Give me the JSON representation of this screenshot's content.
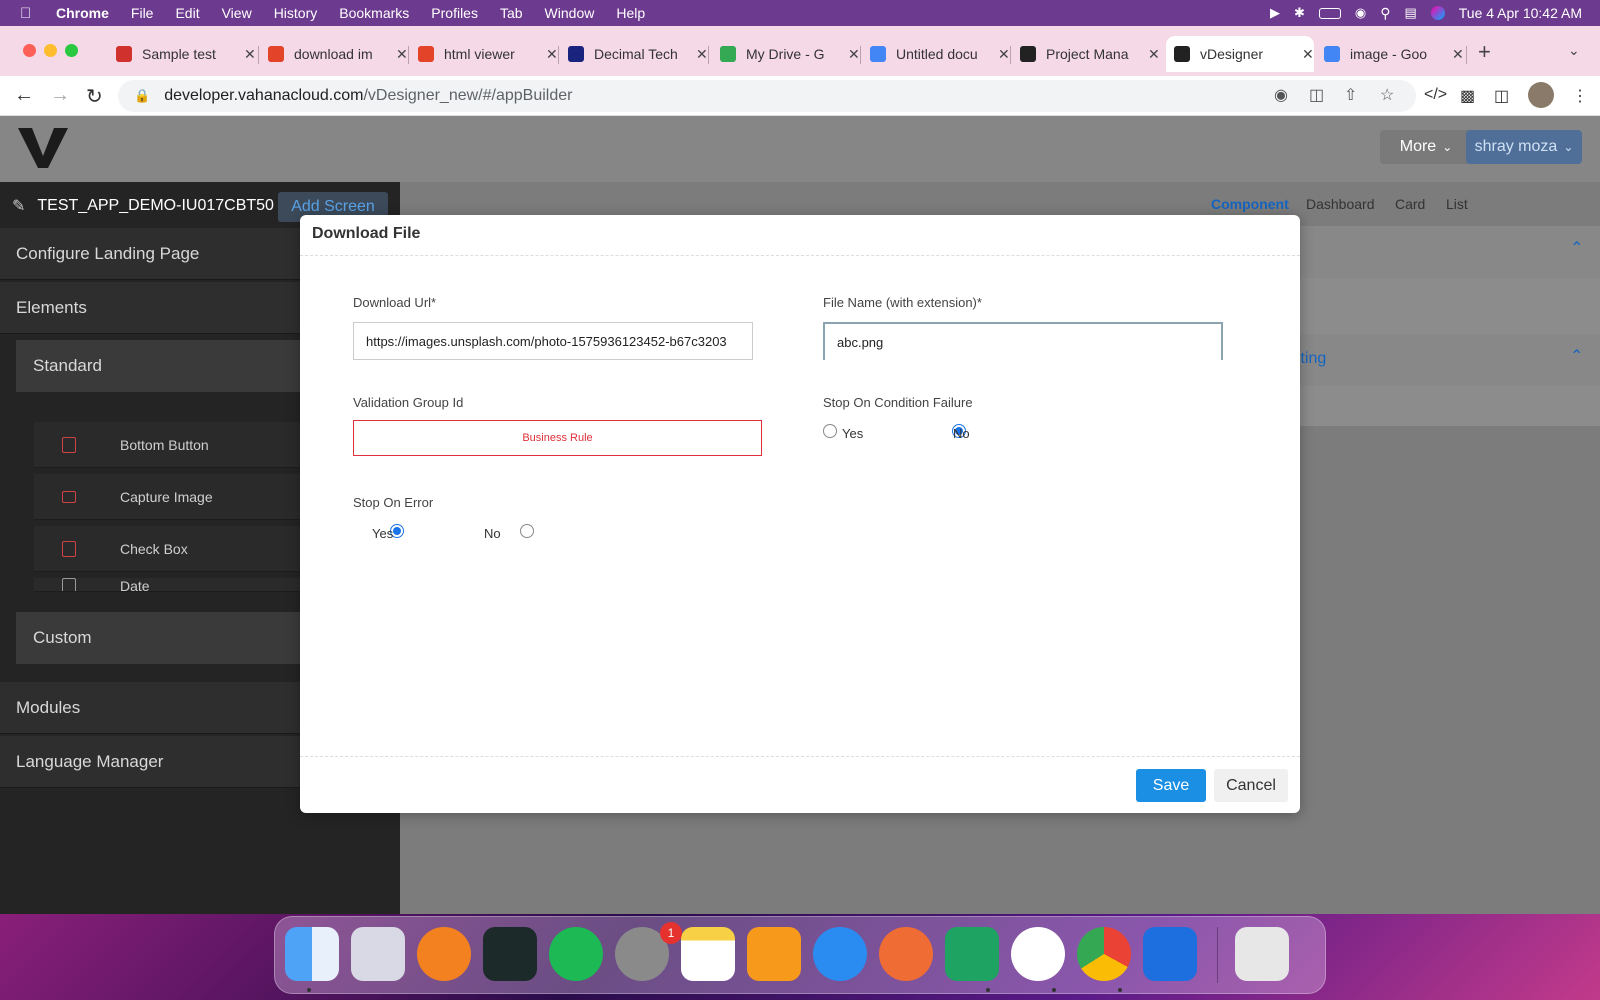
{
  "menubar": {
    "app": "Chrome",
    "items": [
      "File",
      "Edit",
      "View",
      "History",
      "Bookmarks",
      "Profiles",
      "Tab",
      "Window",
      "Help"
    ],
    "datetime": "Tue 4 Apr  10:42 AM"
  },
  "browser": {
    "tabs": [
      {
        "title": "Sample test",
        "favicon_color": "#d0312d"
      },
      {
        "title": "download im",
        "favicon_color": "#e24329"
      },
      {
        "title": "html viewer",
        "favicon_color": "#e24329"
      },
      {
        "title": "Decimal Tech",
        "favicon_color": "#1a237e"
      },
      {
        "title": "My Drive - G",
        "favicon_color": "#34a853"
      },
      {
        "title": "Untitled docu",
        "favicon_color": "#4285f4"
      },
      {
        "title": "Project Mana",
        "favicon_color": "#222222"
      },
      {
        "title": "vDesigner",
        "favicon_color": "#222222",
        "active": true
      },
      {
        "title": "image - Goo",
        "favicon_color": "#4285f4"
      }
    ],
    "url_host": "developer.vahanacloud.com",
    "url_path": "/vDesigner_new/#/appBuilder"
  },
  "app": {
    "more_label": "More",
    "user_label": "shray moza",
    "project_name": "TEST_APP_DEMO-IU017CBT50",
    "add_screen_label": "Add Screen",
    "sections": {
      "configure": "Configure Landing Page",
      "elements": "Elements",
      "standard": "Standard",
      "custom": "Custom",
      "modules": "Modules",
      "language": "Language Manager"
    },
    "elements_list": [
      "Bottom Button",
      "Capture Image",
      "Check Box",
      "Date"
    ],
    "right_tabs": [
      "Component",
      "Dashboard",
      "Card",
      "List"
    ],
    "right_section_fragment": "tting"
  },
  "modal": {
    "title": "Download File",
    "download_url": {
      "label": "Download Url*",
      "value": "https://images.unsplash.com/photo-1575936123452-b67c3203"
    },
    "file_name": {
      "label": "File Name (with extension)*",
      "value": "abc.png"
    },
    "validation_group": {
      "label": "Validation Group Id",
      "value": "Business Rule"
    },
    "stop_on_condition_failure": {
      "label": "Stop On Condition Failure",
      "yes": "Yes",
      "no": "No",
      "selected": "No"
    },
    "stop_on_error": {
      "label": "Stop On Error",
      "yes": "Yes",
      "no": "No",
      "selected": "Yes"
    },
    "save_label": "Save",
    "cancel_label": "Cancel"
  },
  "dock": {
    "apps": [
      "Finder",
      "Launchpad",
      "Cloudflare WARP",
      "Activity Monitor",
      "Spotify",
      "System Settings",
      "Notes",
      "Pages",
      "Safari",
      "Postman",
      "Google Chat",
      "Android Studio",
      "Chrome",
      "Xcode",
      "Trash"
    ],
    "settings_badge": "1"
  },
  "colors": {
    "accent": "#1a8fe3",
    "error": "#e0303a",
    "active_tab_text": "#1565c0"
  }
}
